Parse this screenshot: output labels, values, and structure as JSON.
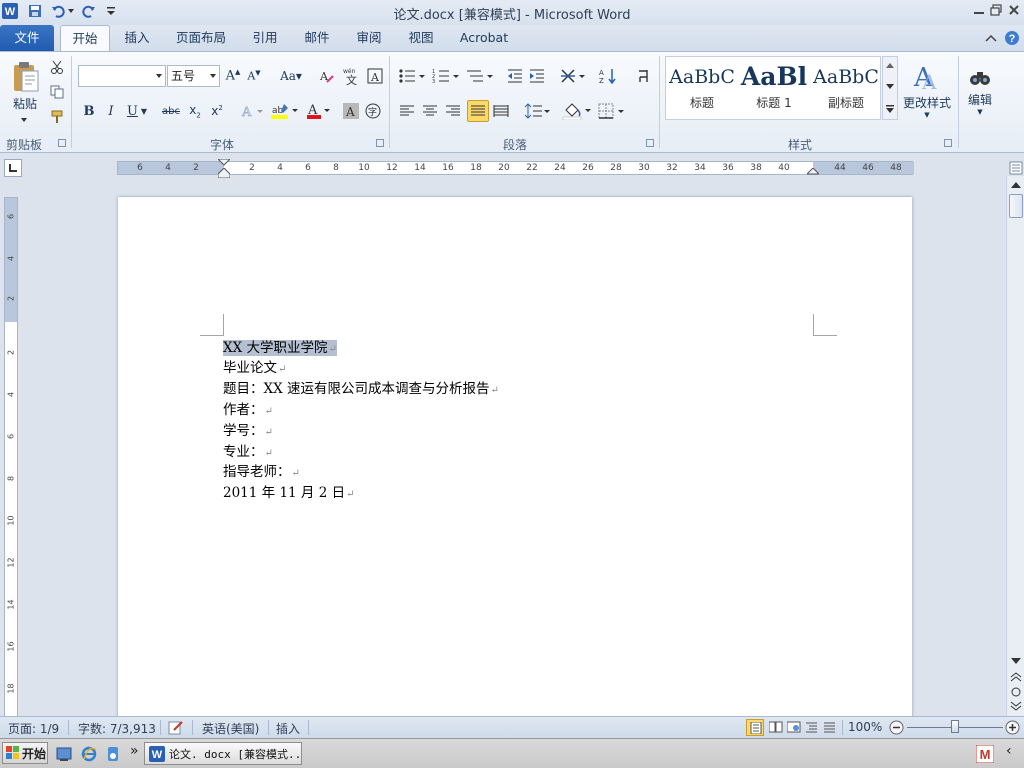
{
  "window": {
    "title": "论文.docx [兼容模式] - Microsoft Word"
  },
  "tabs": [
    {
      "label": "文件"
    },
    {
      "label": "开始"
    },
    {
      "label": "插入"
    },
    {
      "label": "页面布局"
    },
    {
      "label": "引用"
    },
    {
      "label": "邮件"
    },
    {
      "label": "审阅"
    },
    {
      "label": "视图"
    },
    {
      "label": "Acrobat"
    }
  ],
  "ribbon": {
    "clipboard": {
      "paste_label": "粘贴",
      "group_label": "剪贴板"
    },
    "font": {
      "font_name": "",
      "font_size": "五号",
      "group_label": "字体"
    },
    "paragraph": {
      "group_label": "段落"
    },
    "styles": {
      "group_label": "样式",
      "items": [
        {
          "sample": "AaBbC",
          "label": "标题"
        },
        {
          "sample": "AaBl",
          "label": "标题 1"
        },
        {
          "sample": "AaBbC",
          "label": "副标题"
        }
      ],
      "change_styles_label": "更改样式"
    },
    "editing": {
      "label": "编辑"
    }
  },
  "ruler": {
    "numbers": [
      "6",
      "4",
      "2",
      "2",
      "4",
      "6",
      "8",
      "10",
      "12",
      "14",
      "16",
      "18",
      "20",
      "22",
      "24",
      "26",
      "28",
      "30",
      "32",
      "34",
      "36",
      "38",
      "40",
      "44",
      "46",
      "48"
    ]
  },
  "vruler": {
    "numbers": [
      "6",
      "4",
      "2",
      "2",
      "4",
      "6",
      "8",
      "10",
      "12",
      "14",
      "16",
      "18"
    ]
  },
  "document": {
    "lines": [
      {
        "text": "XX 大学职业学院"
      },
      {
        "text": "毕业论文"
      },
      {
        "text": "题目：XX 速运有限公司成本调查与分析报告"
      },
      {
        "text": "作者："
      },
      {
        "text": "学号："
      },
      {
        "text": "专业："
      },
      {
        "text": "指导老师："
      },
      {
        "text": "2011 年 11 月 2 日"
      }
    ],
    "paragraph_mark": "↵"
  },
  "status": {
    "page": "页面: 1/9",
    "words": "字数: 7/3,913",
    "language": "英语(美国)",
    "mode": "插入",
    "zoom": "100%"
  },
  "taskbar": {
    "start_label": "开始",
    "task_label": "论文. docx [兼容模式..."
  },
  "colors": {
    "accent": "#1f5bb0",
    "selection": "#b4bfd1"
  }
}
